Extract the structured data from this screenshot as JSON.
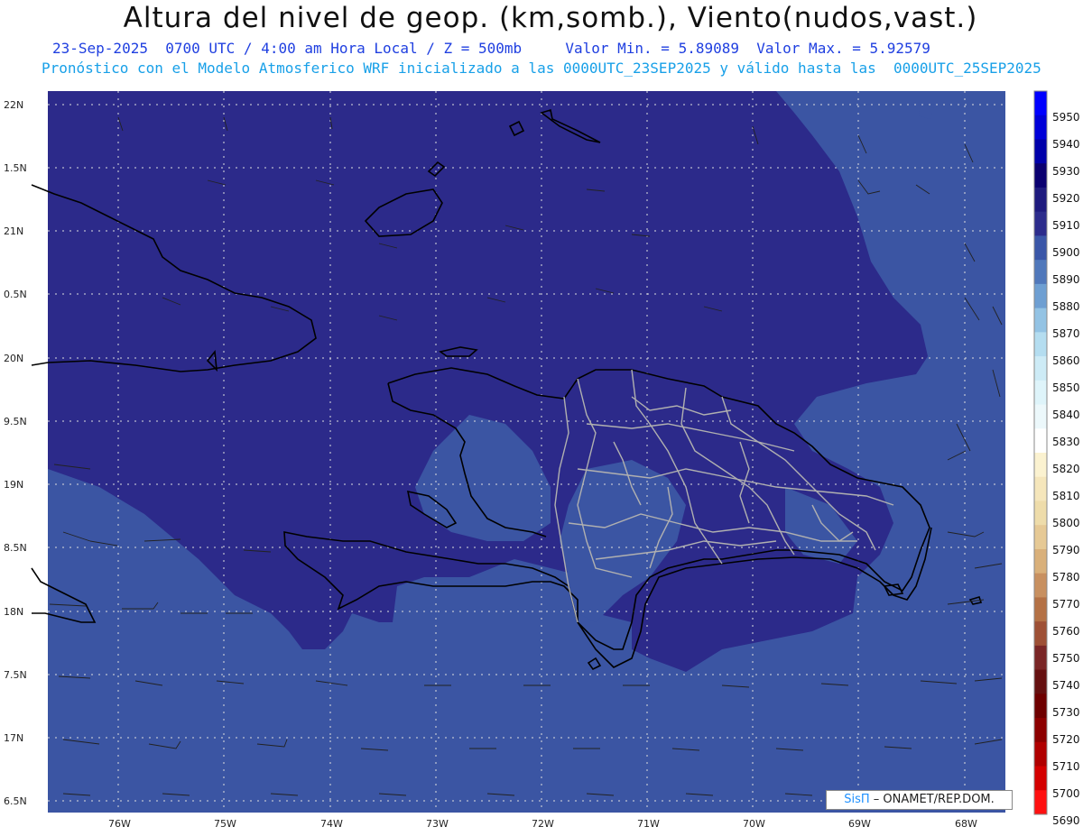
{
  "title": "Altura del nivel de geop. (km,somb.), Viento(nudos,vast.)",
  "subtitle_line1": "23-Sep-2025  0700 UTC / 4:00 am Hora Local / Z = 500mb     Valor Min. = 5.89089  Valor Max. = 5.92579",
  "subtitle_line2": "Pronóstico con el Modelo Atmosferico WRF inicializado a las 0000UTC_23SEP2025 y válido hasta las  0000UTC_25SEP2025",
  "lat_labels": [
    "22N",
    "1.5N",
    "21N",
    "0.5N",
    "20N",
    "9.5N",
    "19N",
    "8.5N",
    "18N",
    "7.5N",
    "17N",
    "6.5N"
  ],
  "lon_labels": [
    "76W",
    "75W",
    "74W",
    "73W",
    "72W",
    "71W",
    "70W",
    "69W",
    "68W"
  ],
  "colorbar": {
    "labels": [
      "5950",
      "5940",
      "5930",
      "5920",
      "5910",
      "5900",
      "5890",
      "5880",
      "5870",
      "5860",
      "5850",
      "5840",
      "5830",
      "5820",
      "5810",
      "5800",
      "5790",
      "5780",
      "5770",
      "5760",
      "5750",
      "5740",
      "5730",
      "5720",
      "5710",
      "5700",
      "5690"
    ],
    "colors": [
      "#0000ff",
      "#0000d8",
      "#0000aa",
      "#0a0070",
      "#1e1a7e",
      "#2c2c8c",
      "#3a56a8",
      "#5078bb",
      "#6e9fd2",
      "#93c3e4",
      "#b4ddf0",
      "#cdebf6",
      "#def4fa",
      "#ecf8fb",
      "#ffffff",
      "#fbf2d0",
      "#f5e6bb",
      "#eedcaa",
      "#e6c995",
      "#d9b07a",
      "#c89060",
      "#b47145",
      "#9e5035",
      "#7a2626",
      "#651010",
      "#6e0000",
      "#8c0000",
      "#b00000",
      "#d40000",
      "#ff1010"
    ]
  },
  "colors": {
    "high_field": "#2c2a8a",
    "low_field": "#3b55a3",
    "coast": "#000000",
    "provinces": "#b0b0b0",
    "grid": "#dddddd"
  },
  "credit": {
    "brand": "SisΠ",
    "text": " – ONAMET/REP.DOM."
  }
}
